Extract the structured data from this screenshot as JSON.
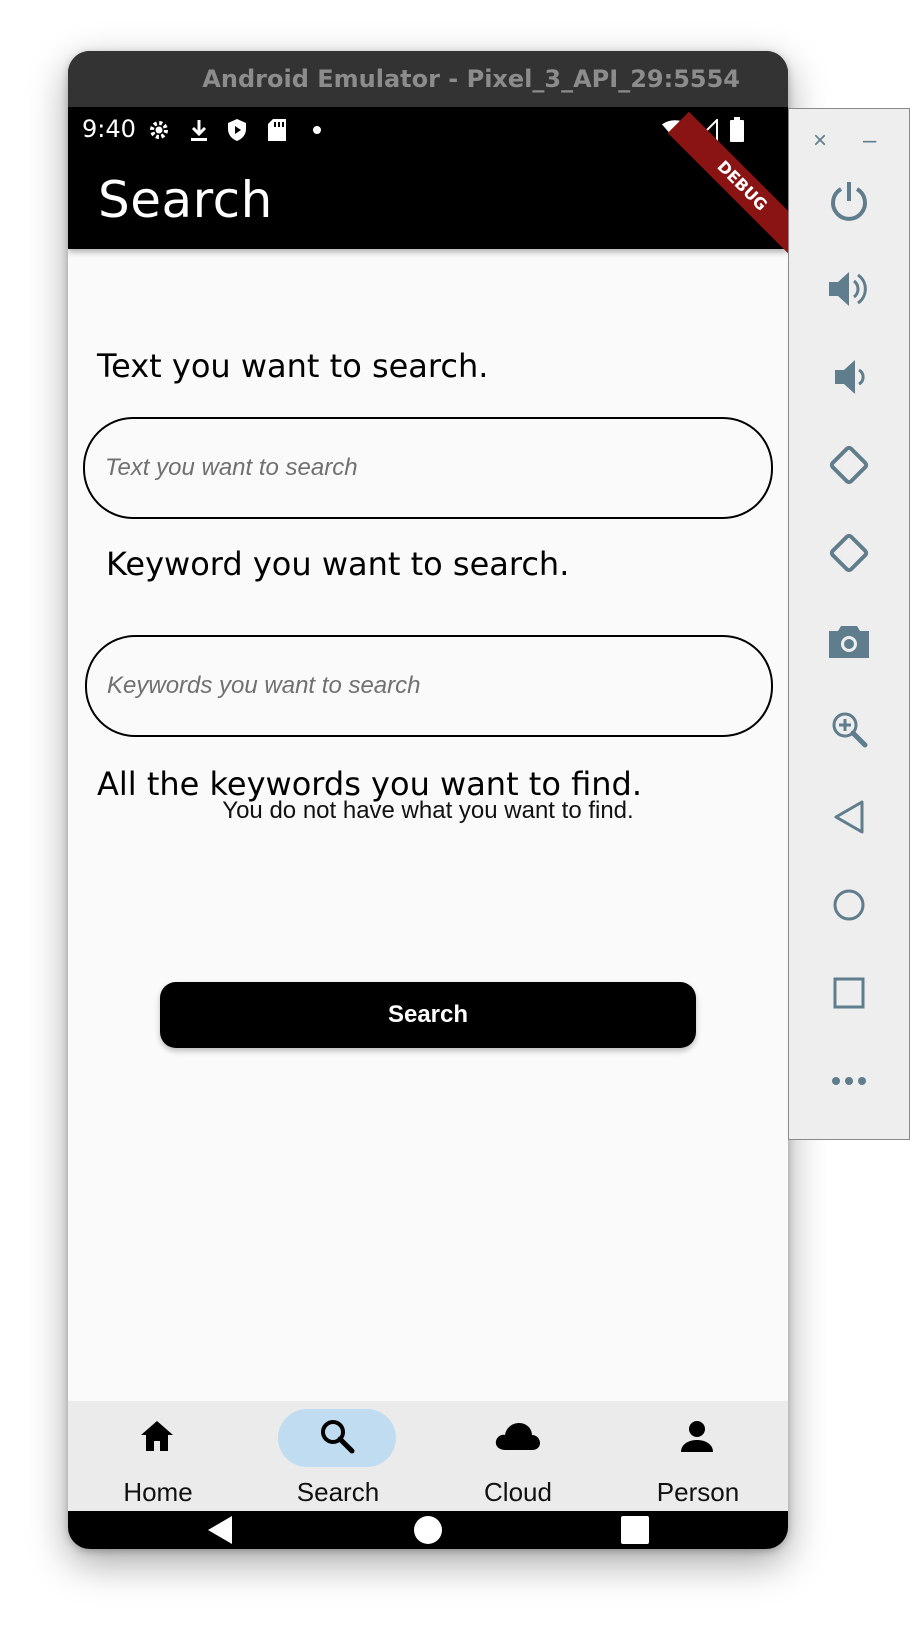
{
  "window": {
    "title": "Android Emulator - Pixel_3_API_29:5554"
  },
  "status_bar": {
    "time": "9:40"
  },
  "app_bar": {
    "title": "Search",
    "debug_banner": "DEBUG"
  },
  "form": {
    "text_label": "Text you want to search.",
    "text_placeholder": "Text you want to search",
    "text_value": "",
    "keyword_label": "Keyword you want to search.",
    "keyword_placeholder": "Keywords you want to search",
    "keyword_value": "",
    "all_keywords_label": "All the keywords you want to find.",
    "empty_message": "You do not have what you want to find.",
    "search_button": "Search"
  },
  "bottom_nav": {
    "active_index": 1,
    "items": [
      {
        "label": "Home",
        "icon": "home-icon"
      },
      {
        "label": "Search",
        "icon": "search-icon"
      },
      {
        "label": "Cloud",
        "icon": "cloud-icon"
      },
      {
        "label": "Person",
        "icon": "person-icon"
      }
    ]
  },
  "sidebar": {
    "close": "×",
    "minimize": "–",
    "buttons": [
      "power-icon",
      "volume-up-icon",
      "volume-down-icon",
      "rotate-left-icon",
      "rotate-right-icon",
      "camera-icon",
      "zoom-icon",
      "back-icon",
      "home-icon",
      "overview-icon",
      "more-icon"
    ]
  },
  "colors": {
    "accent_pill": "#bfdcf0",
    "debug_banner": "#8a1414",
    "sidebar_icon": "#5f7d8c"
  }
}
